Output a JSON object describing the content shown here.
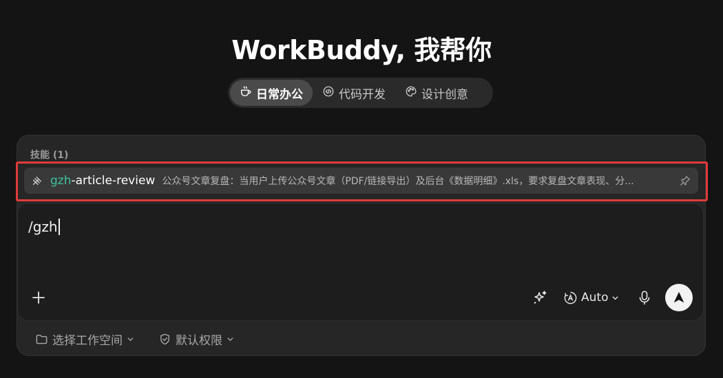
{
  "header": {
    "title": "WorkBuddy, 我帮你"
  },
  "tabs": [
    {
      "label": "日常办公",
      "icon": "coffee-cup-icon",
      "active": true
    },
    {
      "label": "代码开发",
      "icon": "code-icon",
      "active": false
    },
    {
      "label": "设计创意",
      "icon": "palette-icon",
      "active": false
    }
  ],
  "skills": {
    "label": "技能 (1)",
    "items": [
      {
        "name_match": "gzh",
        "name_rest": "-article-review",
        "description": "公众号文章复盘：当用户上传公众号文章（PDF/链接导出）及后台《数据明细》.xls，要求复盘文章表现、分...",
        "icon": "skill-wand-icon",
        "pin_icon": "pin-icon"
      }
    ]
  },
  "input": {
    "value": "/gzh"
  },
  "toolbar": {
    "add_icon": "plus-icon",
    "enhance_icon": "sparkle-icon",
    "model_label": "Auto",
    "model_icon": "auto-model-icon",
    "mic_icon": "microphone-icon",
    "send_icon": "send-arrow-icon"
  },
  "footer": {
    "workspace_label": "选择工作空间",
    "workspace_icon": "folder-icon",
    "permission_label": "默认权限",
    "permission_icon": "shield-check-icon"
  },
  "colors": {
    "background": "#141414",
    "accent_match": "#3fc1a0",
    "highlight_border": "#e23b3b"
  }
}
